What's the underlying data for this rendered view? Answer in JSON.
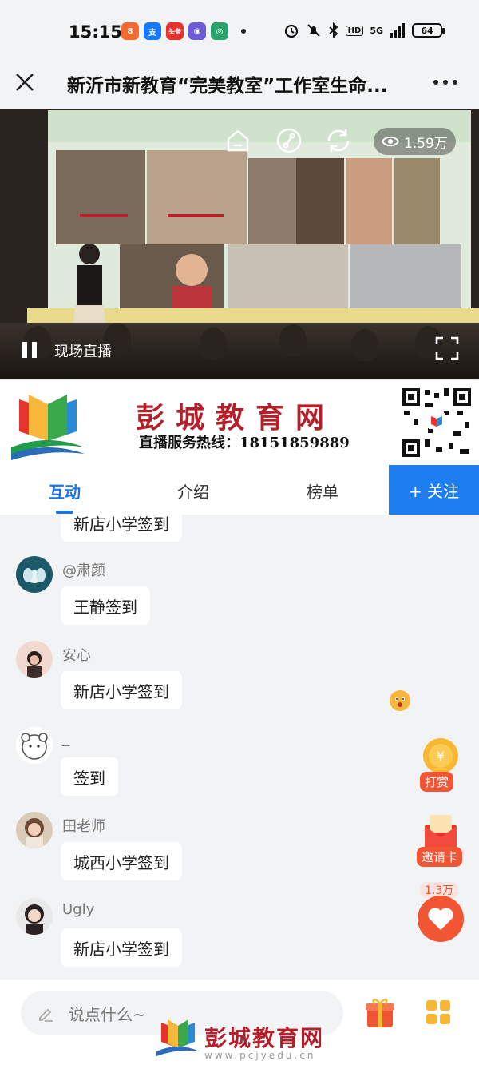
{
  "status_bar": {
    "time": "15:15",
    "apps": [
      {
        "icon": "app-8-icon",
        "color": "#f26a2d",
        "glyph": "8"
      },
      {
        "icon": "alipay-icon",
        "color": "#1677ff",
        "glyph": "支"
      },
      {
        "icon": "toutiao-icon",
        "color": "#e8332c",
        "glyph": "头条"
      },
      {
        "icon": "app-chat-icon",
        "color": "#6b5bd6",
        "glyph": "◉"
      },
      {
        "icon": "app-circle-icon",
        "color": "#2aa36b",
        "glyph": "◎"
      }
    ],
    "network": "5G",
    "hd": "HD",
    "battery": "64"
  },
  "titlebar": {
    "title": "新沂市新教育“完美教室”工作室生命..."
  },
  "video": {
    "views": "1.59万",
    "live_label": "现场直播"
  },
  "banner": {
    "title": "彭城教育网",
    "hotline": "直播服务热线：18151859889"
  },
  "tabs": {
    "items": [
      "互动",
      "介绍",
      "榜单"
    ],
    "active": 0,
    "follow_label": "+ 关注"
  },
  "chat": {
    "partial_bubble": "新店小学签到",
    "messages": [
      {
        "user": "@肃颜",
        "text": "王静签到",
        "avatar": "lotus-avatar"
      },
      {
        "user": "安心",
        "text": "新店小学签到",
        "avatar": "girl-avatar"
      },
      {
        "user": "_",
        "text": "签到",
        "avatar": "bear-avatar"
      },
      {
        "user": "田老师",
        "text": "城西小学签到",
        "avatar": "woman-avatar"
      },
      {
        "user": "Ugly",
        "text": "新店小学签到",
        "avatar": "portrait-avatar"
      }
    ]
  },
  "floating": {
    "tip_label": "打赏",
    "invite_label": "邀请卡",
    "like_count": "1.3万"
  },
  "bottom": {
    "placeholder": "说点什么~",
    "watermark_text": "彭城教育网",
    "watermark_url": "www.pcjyedu.cn"
  },
  "colors": {
    "accent": "#1a73e8",
    "follow_bg": "#1e7ef0",
    "brand_red": "#b3202a",
    "reward_orange": "#f25534"
  }
}
